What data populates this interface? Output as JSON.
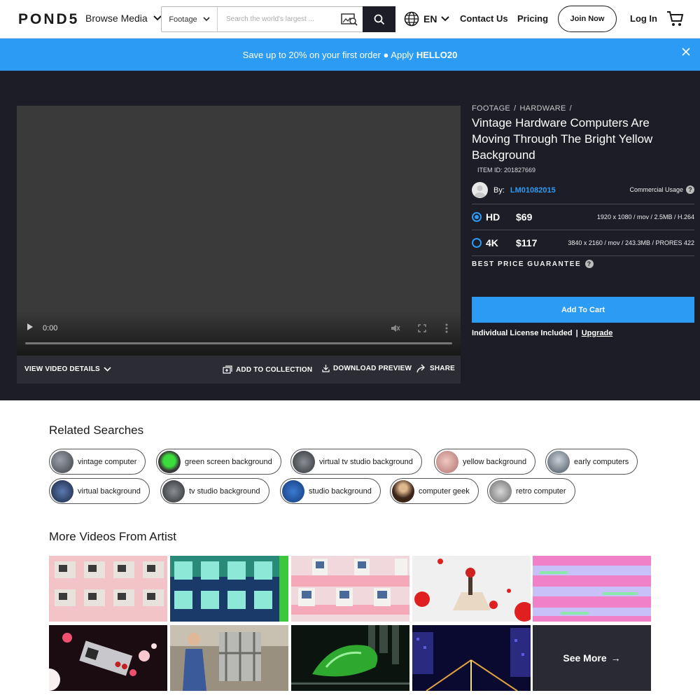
{
  "header": {
    "logo": "POND5",
    "browse_label": "Browse Media",
    "search_type": "Footage",
    "search_placeholder": "Search the world's largest ...",
    "language": "EN",
    "contact": "Contact Us",
    "pricing": "Pricing",
    "join": "Join Now",
    "login": "Log In"
  },
  "promo": {
    "text": "Save up to 20% on your first order ● Apply",
    "code": "HELLO20"
  },
  "player": {
    "time": "0:00"
  },
  "video_actions": {
    "details": "VIEW VIDEO DETAILS",
    "add_collection": "ADD TO COLLECTION",
    "download": "DOWNLOAD PREVIEW",
    "share": "SHARE"
  },
  "detail": {
    "crumb1": "FOOTAGE",
    "crumb2": "HARDWARE",
    "crumb_sep": "/",
    "title": "Vintage Hardware Computers Are Moving Through The Bright Yellow Background",
    "item_id": "ITEM ID: 201827669",
    "by_label": "By:",
    "author": "LM01082015",
    "usage": "Commercial Usage",
    "options": [
      {
        "res": "HD",
        "price": "$69",
        "spec": "1920 x 1080 / mov / 2.5MB / H.264",
        "selected": true
      },
      {
        "res": "4K",
        "price": "$117",
        "spec": "3840 x 2160 / mov / 243.3MB / PRORES 422",
        "selected": false
      }
    ],
    "best_price": "BEST PRICE GUARANTEE",
    "add_to_cart": "Add To Cart",
    "license": "Individual License Included",
    "license_sep": "|",
    "upgrade": "Upgrade"
  },
  "related": {
    "title": "Related Searches",
    "chips": [
      {
        "label": "vintage computer",
        "color": "#5a5f6a"
      },
      {
        "label": "green screen background",
        "color": "#2f8a2f"
      },
      {
        "label": "virtual tv studio background",
        "color": "#555a60"
      },
      {
        "label": "yellow background",
        "color": "#c98a84"
      },
      {
        "label": "early computers",
        "color": "#7d8a96"
      },
      {
        "label": "virtual background",
        "color": "#2d3f6a"
      },
      {
        "label": "tv studio background",
        "color": "#4a4d52"
      },
      {
        "label": "studio background",
        "color": "#1f5aa8"
      },
      {
        "label": "computer geek",
        "color": "#5a3a28"
      },
      {
        "label": "retro computer",
        "color": "#8a8a8a"
      }
    ]
  },
  "artist": {
    "title": "More Videos From Artist",
    "see_more": "See More",
    "see_more_arrow": "→"
  }
}
